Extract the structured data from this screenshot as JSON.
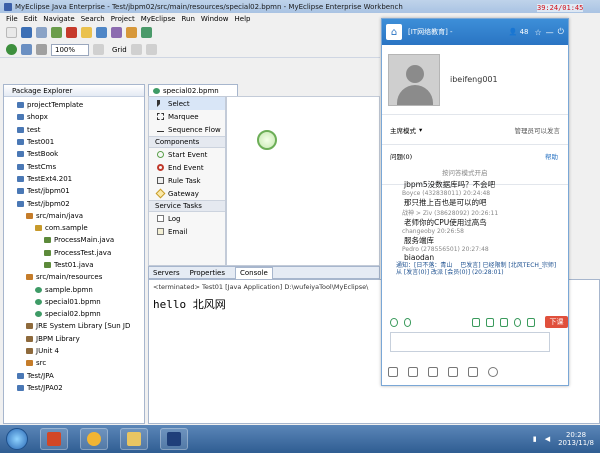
{
  "window": {
    "title": "MyEclipse Java Enterprise - Test/jbpm02/src/main/resources/special02.bpmn - MyEclipse Enterprise Workbench"
  },
  "menu": [
    "File",
    "Edit",
    "Navigate",
    "Search",
    "Project",
    "MyEclipse",
    "Run",
    "Window",
    "Help"
  ],
  "toolbar": {
    "zoom": "100%",
    "grid_label": "Grid"
  },
  "package_explorer": {
    "title": "Package Explorer",
    "items": [
      {
        "label": "projectTemplate",
        "indent": 1,
        "icon": "project-folder-icon"
      },
      {
        "label": "shopx",
        "indent": 1,
        "icon": "project-folder-icon"
      },
      {
        "label": "test",
        "indent": 1,
        "icon": "project-folder-icon"
      },
      {
        "label": "Test001",
        "indent": 1,
        "icon": "project-folder-icon"
      },
      {
        "label": "TestBook",
        "indent": 1,
        "icon": "project-folder-icon"
      },
      {
        "label": "TestCms",
        "indent": 1,
        "icon": "project-folder-icon"
      },
      {
        "label": "TestExt4.201",
        "indent": 1,
        "icon": "project-folder-icon"
      },
      {
        "label": "Test/jbpm01",
        "indent": 1,
        "icon": "project-folder-icon"
      },
      {
        "label": "Test/jbpm02",
        "indent": 1,
        "icon": "project-folder-icon"
      },
      {
        "label": "src/main/java",
        "indent": 2,
        "icon": "source-folder-icon"
      },
      {
        "label": "com.sample",
        "indent": 3,
        "icon": "package-icon"
      },
      {
        "label": "ProcessMain.java",
        "indent": 4,
        "icon": "java-file-icon"
      },
      {
        "label": "ProcessTest.java",
        "indent": 4,
        "icon": "java-file-icon"
      },
      {
        "label": "Test01.java",
        "indent": 4,
        "icon": "java-file-icon"
      },
      {
        "label": "src/main/resources",
        "indent": 2,
        "icon": "source-folder-icon"
      },
      {
        "label": "sample.bpmn",
        "indent": 3,
        "icon": "bpmn-file-icon"
      },
      {
        "label": "special01.bpmn",
        "indent": 3,
        "icon": "bpmn-file-icon"
      },
      {
        "label": "special02.bpmn",
        "indent": 3,
        "icon": "bpmn-file-icon"
      },
      {
        "label": "JRE System Library [Sun JD",
        "indent": 2,
        "icon": "library-icon"
      },
      {
        "label": "JBPM Library",
        "indent": 2,
        "icon": "library-icon"
      },
      {
        "label": "JUnit 4",
        "indent": 2,
        "icon": "library-icon"
      },
      {
        "label": "src",
        "indent": 2,
        "icon": "folder-icon"
      },
      {
        "label": "Test/JPA",
        "indent": 1,
        "icon": "project-folder-icon"
      },
      {
        "label": "Test/JPA02",
        "indent": 1,
        "icon": "project-folder-icon"
      }
    ]
  },
  "editor": {
    "tab": "special02.bpmn",
    "palette": {
      "tools": [
        "Select",
        "Marquee",
        "Sequence Flow"
      ],
      "components_header": "Components",
      "components": [
        "Start Event",
        "End Event",
        "Rule Task",
        "Gateway"
      ],
      "service_header": "Service Tasks",
      "service": [
        "Log",
        "Email"
      ]
    }
  },
  "console": {
    "tabs": [
      "Servers",
      "Properties",
      "Console"
    ],
    "terminated": "<terminated> Test01 [Java Application] D:\\wufeiyaTool\\MyEclipse\\",
    "output": "hello 北风网"
  },
  "qq": {
    "title": "[IT网络教育] -",
    "count": "48",
    "username": "ibeifeng001",
    "mode": "主席模式",
    "mode_right": "管理员可以发言",
    "question": "问题(0)",
    "help": "帮助",
    "question_hint": "按问答模式开启",
    "chat": [
      {
        "type": "msg",
        "text": "jbpm5没数据库吗？不会吧"
      },
      {
        "type": "meta",
        "text": "Boyce (432838011) 20:24:48"
      },
      {
        "type": "msg",
        "text": "那只推上百也是可以的吧"
      },
      {
        "type": "meta",
        "text": "战神 > Ziv (38628092) 20:26:11"
      },
      {
        "type": "msg",
        "text": "老师你的CPU使用过高鸟"
      },
      {
        "type": "meta",
        "text": "changeoby 20:26:58"
      },
      {
        "type": "msg",
        "text": "服务端库"
      },
      {
        "type": "meta",
        "text": "Pedro (278556501) 20:27:48"
      },
      {
        "type": "msg",
        "text": "biaodan"
      },
      {
        "type": "notice",
        "text": "通知：[日不落：青山 　巴发言] 已经限制 [北风TECH_宗师] 从 [发言(0)] 改派 [会员(0)] (20:28:01)"
      }
    ],
    "leave": "下课"
  },
  "overlay_time": "39:24/01:45",
  "taskbar": {
    "time": "20:28",
    "date": "2013/11/8"
  }
}
